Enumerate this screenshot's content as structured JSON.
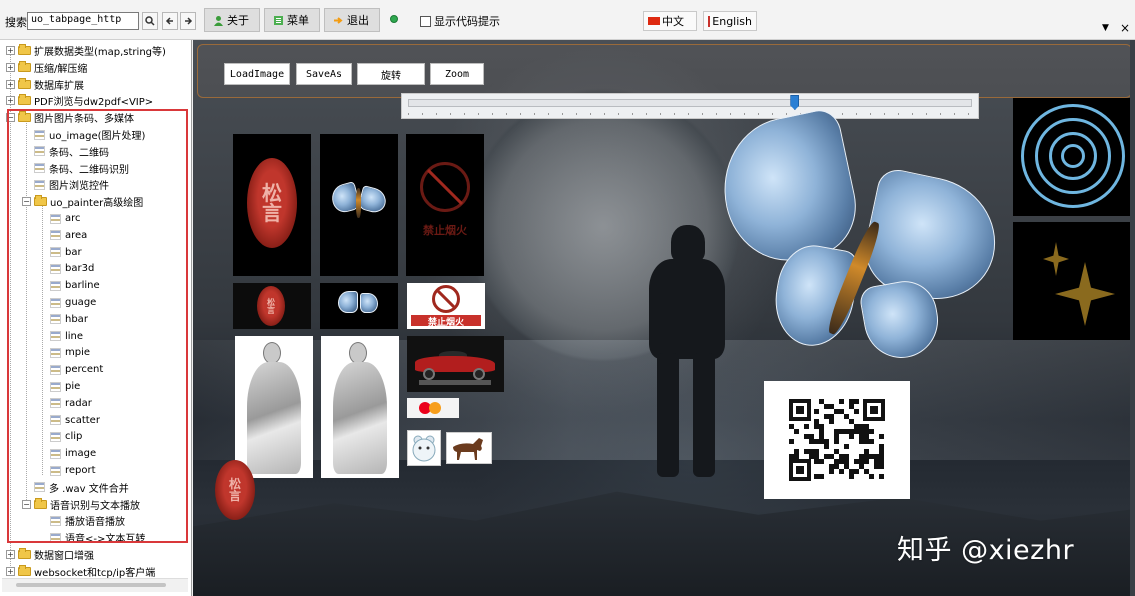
{
  "toolbar": {
    "search_label": "搜索",
    "search_value": "uo_tabpage_http",
    "about_label": "关于",
    "menu_label": "菜单",
    "exit_label": "退出",
    "show_code_hint_label": "显示代码提示",
    "show_code_hint_checked": false,
    "lang_cn_label": "中文",
    "lang_en_label": "English",
    "icons": [
      "search-icon",
      "back-arrow-icon",
      "forward-arrow-icon",
      "user-icon",
      "menu-icon",
      "exit-icon",
      "status-dot-icon",
      "china-flag-icon",
      "pdf-icon",
      "dropdown-icon",
      "close-icon"
    ]
  },
  "sidebar": {
    "items": [
      {
        "label": "扩展数据类型(map,string等)",
        "type": "folder",
        "expanded": false
      },
      {
        "label": "压缩/解压缩",
        "type": "folder",
        "expanded": false
      },
      {
        "label": "数据库扩展",
        "type": "folder",
        "expanded": false
      },
      {
        "label": "PDF浏览与dw2pdf<VIP>",
        "type": "folder",
        "expanded": false
      },
      {
        "label": "图片图片条码、多媒体",
        "type": "folder",
        "expanded": true
      },
      {
        "label": "uo_image(图片处理)",
        "type": "doc"
      },
      {
        "label": "条码、二维码",
        "type": "doc"
      },
      {
        "label": "条码、二维码识别",
        "type": "doc"
      },
      {
        "label": "图片浏览控件",
        "type": "doc"
      },
      {
        "label": "uo_painter高级绘图",
        "type": "folder",
        "expanded": true
      },
      {
        "label": "arc",
        "type": "doc"
      },
      {
        "label": "area",
        "type": "doc"
      },
      {
        "label": "bar",
        "type": "doc"
      },
      {
        "label": "bar3d",
        "type": "doc"
      },
      {
        "label": "barline",
        "type": "doc"
      },
      {
        "label": "guage",
        "type": "doc"
      },
      {
        "label": "hbar",
        "type": "doc"
      },
      {
        "label": "line",
        "type": "doc"
      },
      {
        "label": "mpie",
        "type": "doc"
      },
      {
        "label": "percent",
        "type": "doc"
      },
      {
        "label": "pie",
        "type": "doc"
      },
      {
        "label": "radar",
        "type": "doc"
      },
      {
        "label": "scatter",
        "type": "doc"
      },
      {
        "label": "clip",
        "type": "doc"
      },
      {
        "label": "image",
        "type": "doc"
      },
      {
        "label": "report",
        "type": "doc"
      },
      {
        "label": "多 .wav 文件合并",
        "type": "doc"
      },
      {
        "label": "语音识别与文本播放",
        "type": "folder",
        "expanded": true
      },
      {
        "label": "播放语音播放",
        "type": "doc"
      },
      {
        "label": "语音<->文本互转",
        "type": "doc"
      },
      {
        "label": "数据窗口增强",
        "type": "folder",
        "expanded": false
      },
      {
        "label": "websocket和tcp/ip客户端",
        "type": "folder",
        "expanded": false
      }
    ]
  },
  "stage": {
    "buttons": {
      "load_image": "LoadImage",
      "save_as": "SaveAs",
      "rotate": "旋转",
      "zoom": "Zoom"
    },
    "zoom_slider_value": 0.69,
    "seal_glyph": "松言",
    "no_smoking_text": "禁止烟火",
    "watermark": "知乎 @xiezhr"
  }
}
